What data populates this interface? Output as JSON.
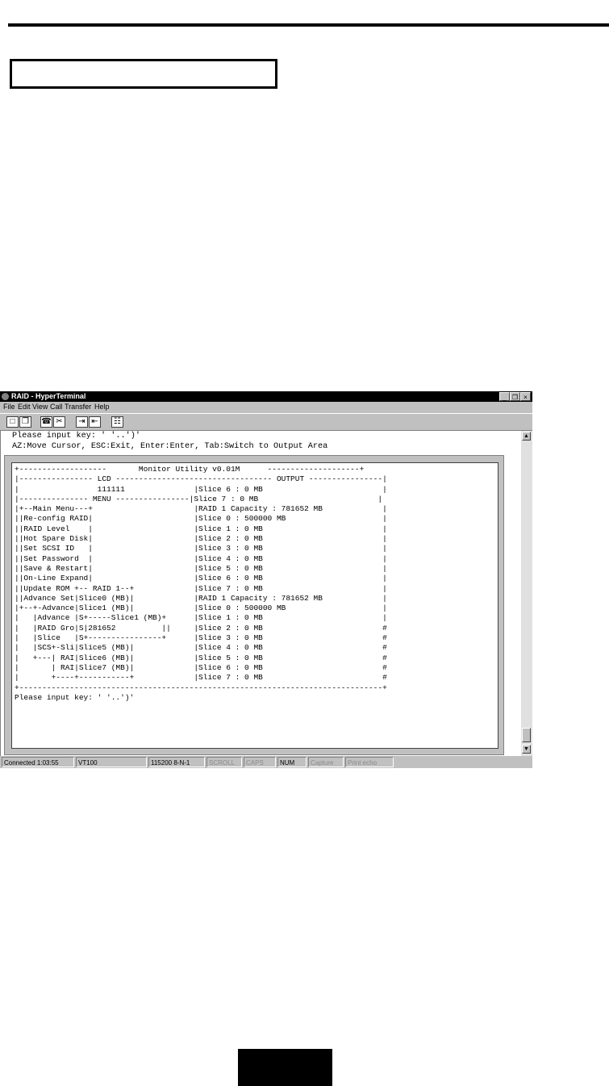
{
  "window": {
    "title": "RAID - HyperTerminal",
    "controls": [
      "_",
      "❒",
      "×"
    ]
  },
  "menu": [
    "File",
    "Edit",
    "View",
    "Call",
    "Transfer",
    "Help"
  ],
  "toolbar": [
    {
      "name": "new-connection",
      "glyph": "□"
    },
    {
      "name": "open",
      "glyph": "❐"
    },
    {
      "name": "connect",
      "glyph": "☎"
    },
    {
      "name": "disconnect",
      "glyph": "✂"
    },
    {
      "name": "send",
      "glyph": "⇥"
    },
    {
      "name": "receive",
      "glyph": "⇤"
    },
    {
      "name": "properties",
      "glyph": "☷"
    }
  ],
  "terminal": {
    "top_lines": [
      "Please input key: ' '..')'",
      "AZ:Move Cursor, ESC:Exit, Enter:Enter, Tab:Switch to Output Area"
    ],
    "screen": [
      "+-------------------       Monitor Utility v0.01M      --------------------+",
      "|---------------- LCD ---------------------------------- OUTPUT ----------------|",
      "|                 111111               |Slice 6 : 0 MB                          |",
      "|--------------- MENU ----------------|Slice 7 : 0 MB                          |",
      "|+--Main Menu---+                      |RAID 1 Capacity : 781652 MB             |",
      "||Re-config RAID|                      |Slice 0 : 500000 MB                     |",
      "||RAID Level    |                      |Slice 1 : 0 MB                          |",
      "||Hot Spare Disk|                      |Slice 2 : 0 MB                          |",
      "||Set SCSI ID   |                      |Slice 3 : 0 MB                          |",
      "||Set Password  |                      |Slice 4 : 0 MB                          |",
      "||Save & Restart|                      |Slice 5 : 0 MB                          |",
      "||On-Line Expand|                      |Slice 6 : 0 MB                          |",
      "||Update ROM +-- RAID 1--+             |Slice 7 : 0 MB                          |",
      "||Advance Set|Slice0 (MB)|             |RAID 1 Capacity : 781652 MB             |",
      "|+--+-Advance|Slice1 (MB)|             |Slice 0 : 500000 MB                     |",
      "|   |Advance |S+-----Slice1 (MB)+      |Slice 1 : 0 MB                          |",
      "|   |RAID Gro|S|281652          ||     |Slice 2 : 0 MB                          #",
      "|   |Slice   |S+----------------+      |Slice 3 : 0 MB                          #",
      "|   |SCS+-Sli|Slice5 (MB)|             |Slice 4 : 0 MB                          #",
      "|   +---| RAI|Slice6 (MB)|             |Slice 5 : 0 MB                          #",
      "|       | RAI|Slice7 (MB)|             |Slice 6 : 0 MB                          #",
      "|       +----+-----------+             |Slice 7 : 0 MB                          #",
      "+-------------------------------------------------------------------------------+",
      "Please input key: ' '..')'"
    ]
  },
  "status": {
    "connected": "Connected 1:03:55",
    "emulation": "VT100",
    "port": "115200 8-N-1",
    "indicators": [
      "SCROLL",
      "CAPS",
      "NUM",
      "Capture",
      "Print echo"
    ]
  }
}
